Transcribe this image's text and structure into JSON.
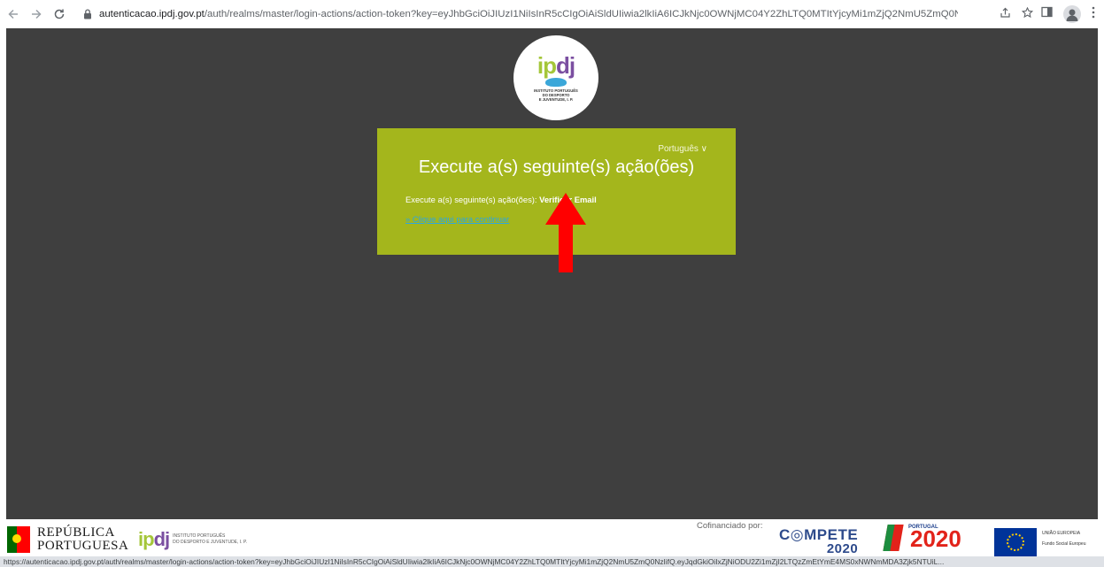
{
  "browser": {
    "url_host": "autenticacao.ipdj.gov.pt",
    "url_path": "/auth/realms/master/login-actions/action-token?key=eyJhbGciOiJIUzI1NiIsInR5cCIgOiAiSldUIiwia2lkIiA6ICJkNjc0OWNjMC04Y2ZhLTQ0MTItYjcyMi1mZjQ2NmU5ZmQ0NzIif...",
    "status_url": "https://autenticacao.ipdj.gov.pt/auth/realms/master/login-actions/action-token?key=eyJhbGciOiJIUzI1NiIsInR5cCIgOiAiSldUIiwia2lkIiA6ICJkNjc0OWNjMC04Y2ZhLTQ0MTItYjcyMi1mZjQ2NmU5ZmQ0NzIifQ.eyJqdGkiOiIxZjNiODU2Zi1mZjI2LTQzZmEtYmE4MS0xNWNmMDA3Zjk5NTUiL..."
  },
  "logo": {
    "word_a": "ip",
    "word_b": "dj",
    "sub_lines": [
      "INSTITUTO PORTUGUÊS",
      "DO DESPORTO",
      "E JUVENTUDE, I. P."
    ]
  },
  "card": {
    "language": "Português ∨",
    "title": "Execute a(s) seguinte(s) ação(ões)",
    "message_prefix": "Execute a(s) seguinte(s) ação(ões): ",
    "message_action": "Verificar Email",
    "continue_link": "» Clique aqui para continuar",
    "background": "#a4b61c"
  },
  "annotation": {
    "arrow_color": "#ff0000"
  },
  "footer": {
    "republica_line1": "REPÚBLICA",
    "republica_line2": "PORTUGUESA",
    "ipdj_a": "ip",
    "ipdj_b": "dj",
    "ipdj_text_1": "INSTITUTO PORTUGUÊS",
    "ipdj_text_2": "DO DESPORTO E JUVENTUDE, I. P.",
    "cofinanciado": "Cofinanciado por:",
    "compete": "C◎MPETE",
    "compete_year": "2020",
    "portugal_label": "PORTUGAL",
    "portugal_year": "2020",
    "eu_line1": "UNIÃO EUROPEIA",
    "eu_line2": "Fundo Social Europeu"
  }
}
